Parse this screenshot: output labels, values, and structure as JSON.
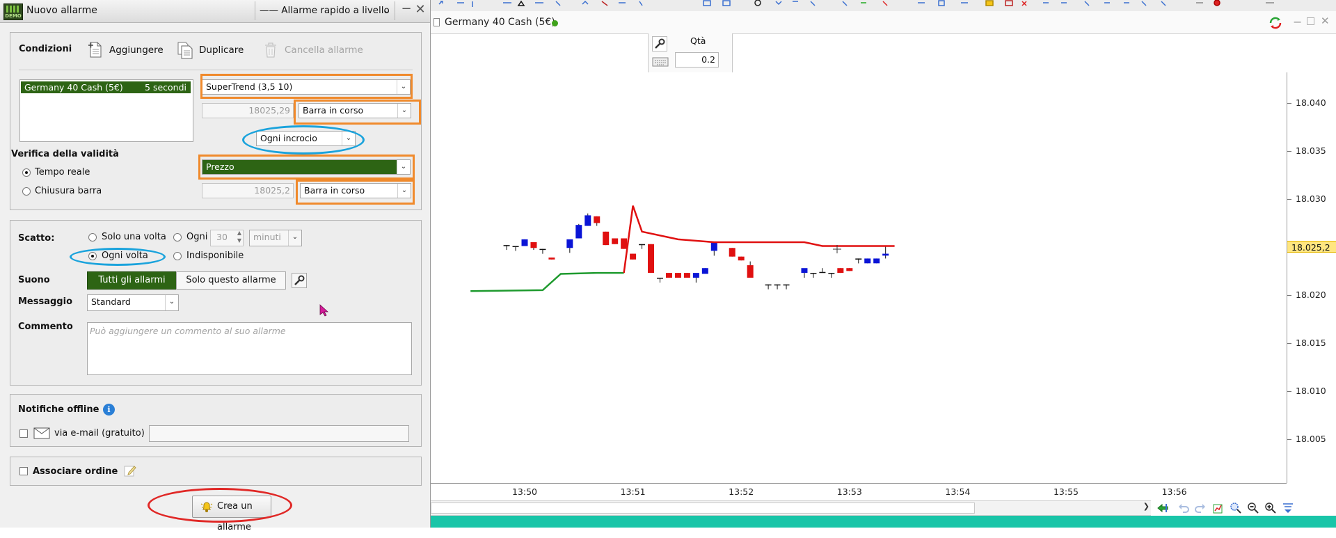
{
  "dialog": {
    "title": "Nuovo allarme",
    "quick_alert_label": "—— Allarme rapido a livello",
    "conditions": {
      "heading": "Condizioni",
      "add_label": "Aggiungere",
      "duplicate_label": "Duplicare",
      "delete_label": "Cancella allarme"
    },
    "alert_list": [
      {
        "instrument": "Germany 40 Cash (5€)",
        "timeframe": "5 secondi"
      }
    ],
    "indicator_select": "SuperTrend (3,5 10)",
    "indicator_value": "18025,29",
    "indicator_bar": "Barra in corso",
    "operator_select": "Ogni incrocio",
    "price_select": "Prezzo",
    "price_value": "18025,2",
    "price_bar": "Barra in corso",
    "validity": {
      "heading": "Verifica della validità",
      "realtime_label": "Tempo reale",
      "bar_close_label": "Chiusura barra"
    },
    "trigger": {
      "label": "Scatto:",
      "once_label": "Solo una volta",
      "every_label": "Ogni",
      "every_value": "30",
      "every_unit": "minuti",
      "each_time_label": "Ogni volta",
      "unavailable_label": "Indisponibile"
    },
    "sound": {
      "label": "Suono",
      "all_alerts": "Tutti gli allarmi",
      "this_alert": "Solo questo allarme"
    },
    "message": {
      "label": "Messaggio",
      "value": "Standard"
    },
    "comment": {
      "label": "Commento",
      "placeholder": "Può aggiungere un commento al suo allarme"
    },
    "offline": {
      "heading": "Notifiche offline",
      "email_label": "via e-mail (gratuito)"
    },
    "order": {
      "label": "Associare ordine"
    },
    "create_button": "Crea un allarme"
  },
  "chart": {
    "title": "Germany 40 Cash (5€)",
    "qty_label": "Qtà",
    "qty_value": "0.2",
    "price_ticks": [
      "18.040",
      "18.035",
      "18.030",
      "18.025,2",
      "18.020",
      "18.015",
      "18.010",
      "18.005"
    ],
    "current_price": "18.025,2",
    "time_ticks": [
      "13:50",
      "13:51",
      "13:52",
      "13:53",
      "13:54",
      "13:55",
      "13:56"
    ],
    "colors": {
      "bull": "#0a14d6",
      "bear": "#e01010",
      "supertrend_up": "#1e9a2e",
      "supertrend_down": "#e01010",
      "price_tag": "#ffe680"
    }
  },
  "chart_data": {
    "type": "candlestick",
    "ylim": [
      18000.5,
      18043.3
    ],
    "ohlc": [
      {
        "x": "13:49:50",
        "o": 18025.3,
        "h": 18025.3,
        "l": 18025.3,
        "c": 18025.3
      },
      {
        "x": "13:49:55",
        "o": 18025.2,
        "h": 18025.2,
        "l": 18025.2,
        "c": 18025.2
      },
      {
        "x": "13:50:00",
        "o": 18025.2,
        "h": 18025.9,
        "l": 18025.2,
        "c": 18025.9
      },
      {
        "x": "13:50:05",
        "o": 18025.6,
        "h": 18025.6,
        "l": 18024.8,
        "c": 18025.0
      },
      {
        "x": "13:50:10",
        "o": 18024.9,
        "h": 18024.9,
        "l": 18024.9,
        "c": 18024.9
      },
      {
        "x": "13:50:15",
        "o": 18024.0,
        "h": 18024.0,
        "l": 18023.8,
        "c": 18023.8
      },
      {
        "x": "13:50:25",
        "o": 18025.0,
        "h": 18025.0,
        "l": 18025.0,
        "c": 18025.9
      },
      {
        "x": "13:50:30",
        "o": 18026.0,
        "h": 18027.5,
        "l": 18026.0,
        "c": 18027.4
      },
      {
        "x": "13:50:35",
        "o": 18027.3,
        "h": 18028.6,
        "l": 18027.3,
        "c": 18028.4
      },
      {
        "x": "13:50:40",
        "o": 18028.3,
        "h": 18028.3,
        "l": 18027.3,
        "c": 18027.6
      },
      {
        "x": "13:50:45",
        "o": 18026.7,
        "h": 18026.7,
        "l": 18025.3,
        "c": 18025.3
      },
      {
        "x": "13:50:50",
        "o": 18026.0,
        "h": 18026.0,
        "l": 18025.4,
        "c": 18025.4
      },
      {
        "x": "13:50:55",
        "o": 18026.0,
        "h": 18026.0,
        "l": 18024.9,
        "c": 18024.9
      },
      {
        "x": "13:51:00",
        "o": 18024.4,
        "h": 18024.4,
        "l": 18023.8,
        "c": 18023.8
      },
      {
        "x": "13:51:05",
        "o": 18025.4,
        "h": 18025.4,
        "l": 18025.4,
        "c": 18025.4
      },
      {
        "x": "13:51:10",
        "o": 18025.4,
        "h": 18025.4,
        "l": 18022.4,
        "c": 18022.4
      },
      {
        "x": "13:51:15",
        "o": 18021.9,
        "h": 18021.9,
        "l": 18021.9,
        "c": 18021.9
      },
      {
        "x": "13:51:20",
        "o": 18022.4,
        "h": 18022.4,
        "l": 18021.9,
        "c": 18021.9
      },
      {
        "x": "13:51:25",
        "o": 18022.4,
        "h": 18022.4,
        "l": 18021.9,
        "c": 18021.9
      },
      {
        "x": "13:51:30",
        "o": 18022.4,
        "h": 18022.4,
        "l": 18021.9,
        "c": 18021.9
      },
      {
        "x": "13:51:35",
        "o": 18021.9,
        "h": 18021.9,
        "l": 18021.9,
        "c": 18022.4
      },
      {
        "x": "13:51:40",
        "o": 18022.3,
        "h": 18022.9,
        "l": 18022.3,
        "c": 18022.9
      },
      {
        "x": "13:51:45",
        "o": 18024.7,
        "h": 18024.7,
        "l": 18024.7,
        "c": 18025.6
      },
      {
        "x": "13:51:55",
        "o": 18025.0,
        "h": 18025.0,
        "l": 18024.1,
        "c": 18024.1
      },
      {
        "x": "13:52:00",
        "o": 18024.1,
        "h": 18024.1,
        "l": 18023.7,
        "c": 18023.7
      },
      {
        "x": "13:52:05",
        "o": 18023.2,
        "h": 18023.6,
        "l": 18021.9,
        "c": 18021.9
      },
      {
        "x": "13:52:15",
        "o": 18021.2,
        "h": 18021.2,
        "l": 18021.2,
        "c": 18021.2
      },
      {
        "x": "13:52:20",
        "o": 18021.2,
        "h": 18021.2,
        "l": 18021.2,
        "c": 18021.2
      },
      {
        "x": "13:52:25",
        "o": 18021.2,
        "h": 18021.2,
        "l": 18021.2,
        "c": 18021.2
      },
      {
        "x": "13:52:35",
        "o": 18022.4,
        "h": 18022.4,
        "l": 18022.4,
        "c": 18022.9
      },
      {
        "x": "13:52:40",
        "o": 18022.4,
        "h": 18022.4,
        "l": 18022.4,
        "c": 18022.4
      },
      {
        "x": "13:52:45",
        "o": 18022.5,
        "h": 18022.9,
        "l": 18022.5,
        "c": 18022.5
      },
      {
        "x": "13:52:50",
        "o": 18022.4,
        "h": 18022.4,
        "l": 18022.4,
        "c": 18022.4
      },
      {
        "x": "13:52:55",
        "o": 18022.9,
        "h": 18022.9,
        "l": 18022.4,
        "c": 18022.4
      },
      {
        "x": "13:53:00",
        "o": 18022.9,
        "h": 18022.9,
        "l": 18022.6,
        "c": 18022.6
      },
      {
        "x": "13:53:05",
        "o": 18023.9,
        "h": 18023.9,
        "l": 18023.9,
        "c": 18023.9
      },
      {
        "x": "13:53:10",
        "o": 18023.4,
        "h": 18023.9,
        "l": 18023.4,
        "c": 18023.9
      },
      {
        "x": "13:53:15",
        "o": 18023.4,
        "h": 18023.9,
        "l": 18023.4,
        "c": 18023.9
      },
      {
        "x": "13:53:20",
        "o": 18024.2,
        "h": 18025.2,
        "l": 18023.9,
        "c": 18024.4
      }
    ],
    "supertrend": [
      {
        "x": "13:49:30",
        "y": 18020.5
      },
      {
        "x": "13:50:10",
        "y": 18020.6
      },
      {
        "x": "13:50:20",
        "y": 18022.3
      },
      {
        "x": "13:50:40",
        "y": 18022.4
      },
      {
        "x": "13:50:55",
        "y": 18022.4
      },
      {
        "x": "13:51:00",
        "y": 18029.4
      },
      {
        "x": "13:51:05",
        "y": 18026.7
      },
      {
        "x": "13:51:25",
        "y": 18025.9
      },
      {
        "x": "13:51:45",
        "y": 18025.6
      },
      {
        "x": "13:52:35",
        "y": 18025.6
      },
      {
        "x": "13:52:45",
        "y": 18025.2
      },
      {
        "x": "13:53:25",
        "y": 18025.2
      }
    ]
  }
}
